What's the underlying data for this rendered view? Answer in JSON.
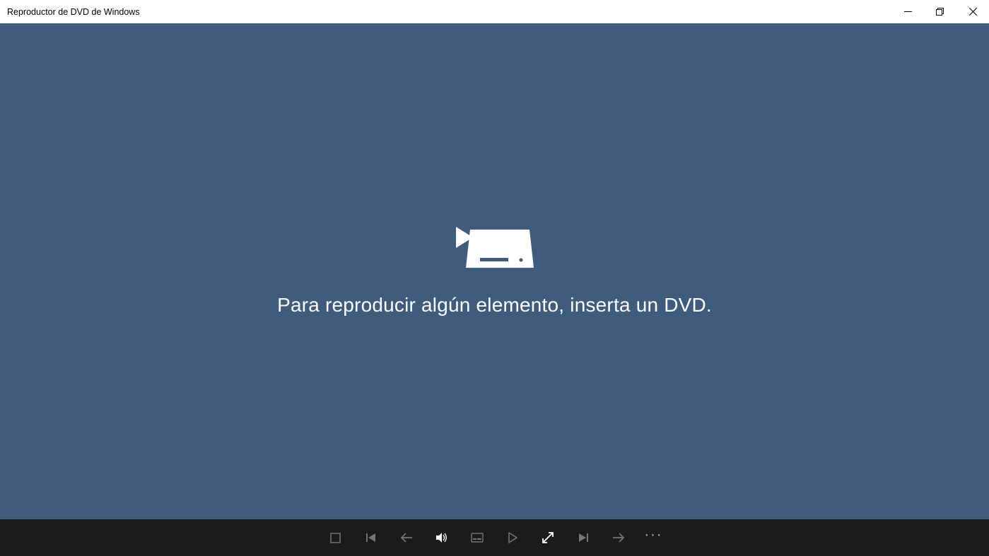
{
  "window": {
    "title": "Reproductor de DVD de Windows"
  },
  "content": {
    "message": "Para reproducir algún elemento, inserta un DVD."
  },
  "controls": {
    "more": "···"
  }
}
